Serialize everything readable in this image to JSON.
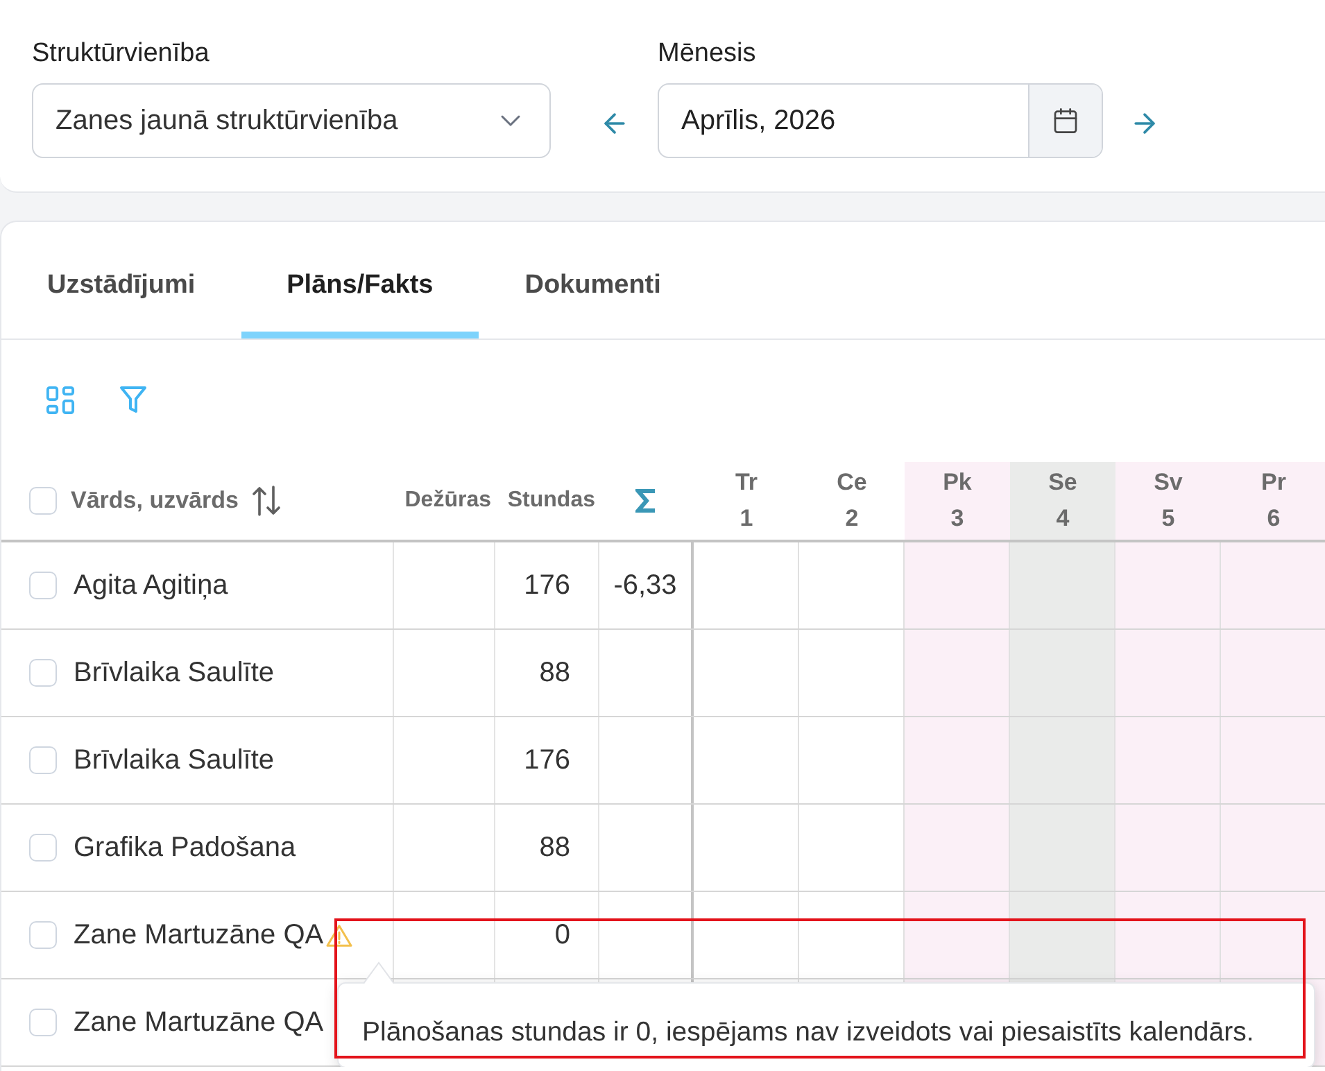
{
  "filters": {
    "unit": {
      "label": "Struktūrvienība",
      "value": "Zanes jaunā struktūrvienība"
    },
    "month": {
      "label": "Mēnesis",
      "value": "Aprīlis, 2026"
    }
  },
  "tabs": [
    {
      "label": "Uzstādījumi",
      "selected": false
    },
    {
      "label": "Plāns/Fakts",
      "selected": true
    },
    {
      "label": "Dokumenti",
      "selected": false
    }
  ],
  "table": {
    "select_all": {
      "checked": false
    },
    "columns": [
      {
        "label": "Vārds, uzvārds",
        "kind": "name"
      },
      {
        "label": "Dežūras",
        "kind": "text"
      },
      {
        "label": "Stundas",
        "kind": "text"
      },
      {
        "kind": "sum"
      }
    ],
    "days": [
      {
        "weekday": "Tr",
        "day": "1",
        "kind": "workday"
      },
      {
        "weekday": "Ce",
        "day": "2",
        "kind": "workday"
      },
      {
        "weekday": "Pk",
        "day": "3",
        "kind": "holiday"
      },
      {
        "weekday": "Se",
        "day": "4",
        "kind": "weekend"
      },
      {
        "weekday": "Sv",
        "day": "5",
        "kind": "holiday"
      },
      {
        "weekday": "Pr",
        "day": "6",
        "kind": "holiday"
      }
    ],
    "rows": [
      {
        "name": "Agita Agitiņa",
        "checked": false,
        "warning": false,
        "hours": "176",
        "sum": "-6,33"
      },
      {
        "name": "Brīvlaika Saulīte",
        "checked": false,
        "warning": false,
        "hours": "88"
      },
      {
        "name": "Brīvlaika Saulīte",
        "checked": false,
        "warning": false,
        "hours": "176"
      },
      {
        "name": "Grafika Padošana",
        "checked": false,
        "warning": false,
        "hours": "88"
      },
      {
        "name": "Zane Martuzāne QA",
        "checked": false,
        "warning": true,
        "hours": "0"
      },
      {
        "name": "Zane Martuzāne QA",
        "checked": false,
        "warning": false
      }
    ]
  },
  "tooltip": {
    "text": "Plānošanas stundas ir 0, iespējams nav izveidots vai piesaistīts kalendārs."
  }
}
